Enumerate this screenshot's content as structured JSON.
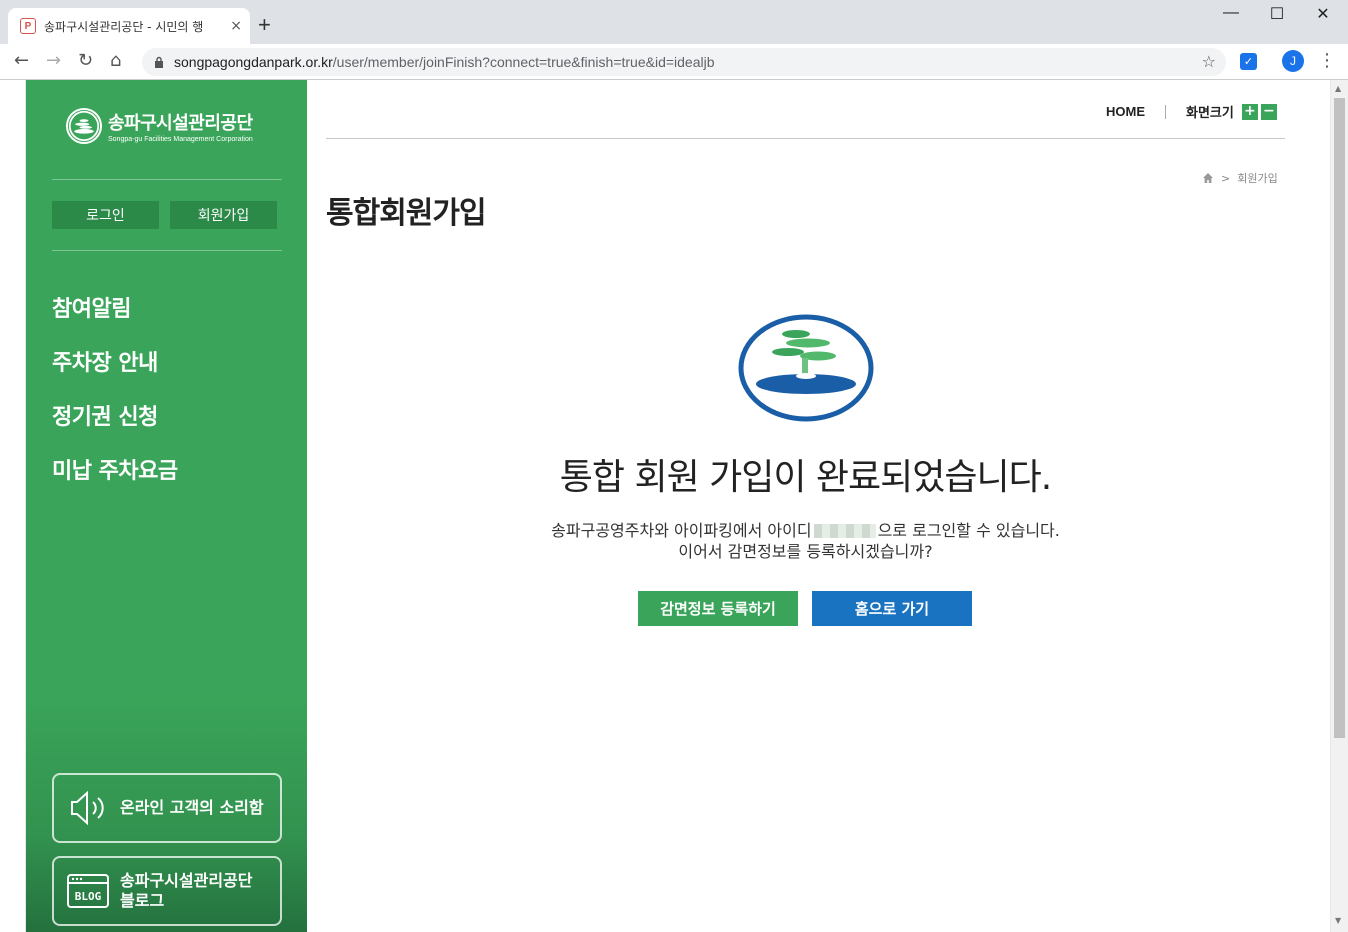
{
  "browser": {
    "tab_title": "송파구시설관리공단 - 시민의 행",
    "tab_close": "×",
    "favicon": "P",
    "new_tab": "+",
    "url_host": "songpagongdanpark.or.kr",
    "url_path": "/user/member/joinFinish?connect=true&finish=true&id=idealjb",
    "avatar": "J",
    "win_min": "—",
    "win_max": "☐",
    "win_close": "✕",
    "back": "←",
    "forward": "→",
    "reload": "↻",
    "home": "⌂",
    "star": "☆",
    "menu": "⋮"
  },
  "sidebar": {
    "logo_kr": "송파구시설관리공단",
    "logo_en": "Songpa-gu Facilities Management Corporation",
    "login": "로그인",
    "join": "회원가입",
    "menu": [
      "참여알림",
      "주차장 안내",
      "정기권 신청",
      "미납 주차요금"
    ],
    "voice_box": "온라인 고객의 소리함",
    "blog_line1": "송파구시설관리공단",
    "blog_line2": "블로그",
    "blog_icon_text": "BLOG"
  },
  "header": {
    "home": "HOME",
    "font_size": "화면크기",
    "zoom_in": "+",
    "zoom_out": "−",
    "breadcrumb_current": "회원가입",
    "breadcrumb_sep": ">"
  },
  "main": {
    "title": "통합회원가입",
    "done_title": "통합 회원 가입이 완료되었습니다.",
    "msg_before": "송파구공영주차와 아이파킹에서 아이디",
    "msg_after": "으로 로그인할 수 있습니다.",
    "msg_line2": "이어서 감면정보를 등록하시겠습니까?",
    "btn_register": "감면정보 등록하기",
    "btn_home": "홈으로 가기"
  },
  "colors": {
    "brand_green": "#3aa55a",
    "brand_blue": "#1a73c1"
  }
}
